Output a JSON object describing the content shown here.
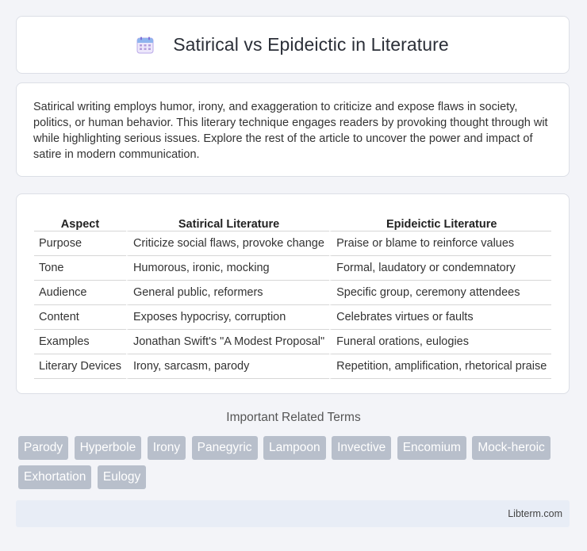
{
  "header": {
    "title": "Satirical vs Epideictic in Literature",
    "icon": "calendar-icon"
  },
  "intro": {
    "text": "Satirical writing employs humor, irony, and exaggeration to criticize and expose flaws in society, politics, or human behavior. This literary technique engages readers by provoking thought through wit while highlighting serious issues. Explore the rest of the article to uncover the power and impact of satire in modern communication."
  },
  "table": {
    "headers": [
      "Aspect",
      "Satirical Literature",
      "Epideictic Literature"
    ],
    "rows": [
      [
        "Purpose",
        "Criticize social flaws, provoke change",
        "Praise or blame to reinforce values"
      ],
      [
        "Tone",
        "Humorous, ironic, mocking",
        "Formal, laudatory or condemnatory"
      ],
      [
        "Audience",
        "General public, reformers",
        "Specific group, ceremony attendees"
      ],
      [
        "Content",
        "Exposes hypocrisy, corruption",
        "Celebrates virtues or faults"
      ],
      [
        "Examples",
        "Jonathan Swift's \"A Modest Proposal\"",
        "Funeral orations, eulogies"
      ],
      [
        "Literary Devices",
        "Irony, sarcasm, parody",
        "Repetition, amplification, rhetorical praise"
      ]
    ]
  },
  "related": {
    "title": "Important Related Terms",
    "tags": [
      "Parody",
      "Hyperbole",
      "Irony",
      "Panegyric",
      "Lampoon",
      "Invective",
      "Encomium",
      "Mock-heroic",
      "Exhortation",
      "Eulogy"
    ]
  },
  "footer": {
    "text": "Libterm.com"
  },
  "colors": {
    "background": "#f3f4f8",
    "tag_background": "#b8bfcb",
    "footer_background": "#e8edf6"
  }
}
